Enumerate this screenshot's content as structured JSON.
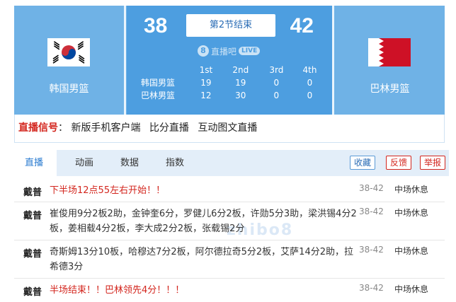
{
  "match": {
    "status": "第2节结束",
    "brand_num": "8",
    "brand_text": "直播吧",
    "brand_live": "LIVE",
    "home": {
      "name": "韩国男篮",
      "score": "38"
    },
    "away": {
      "name": "巴林男篮",
      "score": "42"
    },
    "quarters": {
      "headers": [
        "1st",
        "2nd",
        "3rd",
        "4th"
      ],
      "rows": [
        {
          "team": "韩国男篮",
          "scores": [
            "19",
            "19",
            "0",
            "0"
          ]
        },
        {
          "team": "巴林男篮",
          "scores": [
            "12",
            "30",
            "0",
            "0"
          ]
        }
      ]
    },
    "colors": {
      "header_bg": "#6fb2e6",
      "center_bg": "#4d9ee0",
      "accent_red": "#d3261e"
    }
  },
  "signal": {
    "label": "直播信号",
    "separator": "：",
    "links": [
      "新版手机客户端",
      "比分直播",
      "互动图文直播"
    ]
  },
  "tabs": {
    "items": [
      "直播",
      "动画",
      "数据",
      "指数"
    ],
    "active": "直播",
    "buttons": {
      "favorite": "收藏",
      "feedback": "反馈",
      "report": "举报"
    }
  },
  "feed": {
    "watermark": "zhibo8",
    "items": [
      {
        "author": "戴普",
        "text": "下半场12点55左右开始！！",
        "score": "38-42",
        "quarter": "中场休息",
        "highlight": true
      },
      {
        "author": "戴普",
        "text": "崔俊用9分2板2助，金钟奎6分，罗健儿6分2板，许勋5分3助，梁洪锡4分2板，姜相载4分2板，李大成2分2板，张载锡2分",
        "score": "38-42",
        "quarter": "中场休息",
        "highlight": false
      },
      {
        "author": "戴普",
        "text": "奇斯姆13分10板，哈穆达7分2板，阿尔德拉奇5分2板，艾萨14分2助，拉希德3分",
        "score": "38-42",
        "quarter": "中场休息",
        "highlight": false
      },
      {
        "author": "戴普",
        "text": "半场结束！！巴林领先4分！！！",
        "score": "38-42",
        "quarter": "中场休息",
        "highlight": true
      }
    ]
  }
}
